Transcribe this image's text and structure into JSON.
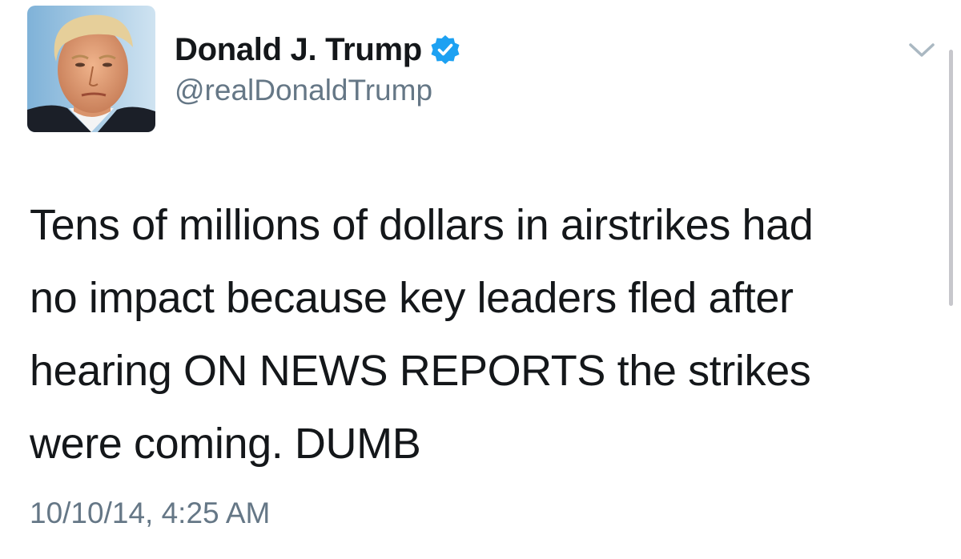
{
  "author": {
    "display_name": "Donald J. Trump",
    "handle": "@realDonaldTrump",
    "verified": true,
    "verified_badge_color": "#1da1f2"
  },
  "tweet": {
    "text": "Tens of millions of dollars in airstrikes had\nno impact because key leaders fled after\nhearing ON NEWS REPORTS the strikes\nwere coming. DUMB",
    "timestamp": "10/10/14, 4:25 AM"
  },
  "controls": {
    "menu_icon": "chevron-down-icon"
  },
  "colors": {
    "text_primary": "#14171a",
    "text_secondary": "#657786",
    "chevron": "#aab8c2"
  }
}
